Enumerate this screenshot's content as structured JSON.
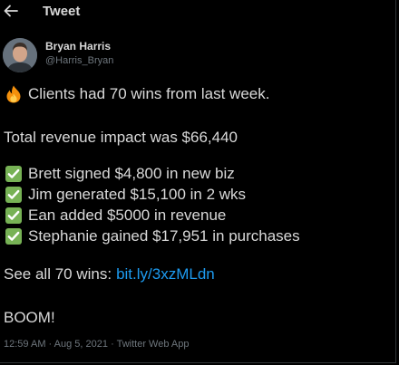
{
  "header": {
    "title": "Tweet",
    "back_icon": "arrow-left-icon"
  },
  "author": {
    "name": "Bryan Harris",
    "handle": "@Harris_Bryan"
  },
  "tweet": {
    "line1_emoji": "fire-icon",
    "line1": "Clients had 70 wins from last week.",
    "line2": "Total revenue impact was $66,440",
    "wins": [
      "Brett signed $4,800 in new biz",
      "Jim generated $15,100 in 2 wks",
      "Ean added $5000 in revenue",
      "Stephanie gained $17,951 in purchases"
    ],
    "wins_icon": "check-mark-button-icon",
    "see_all_text": "See all 70 wins:",
    "see_all_link": "bit.ly/3xzMLdn",
    "closing": "BOOM!"
  },
  "meta": {
    "time": "12:59 AM",
    "date": "Aug 5, 2021",
    "source": "Twitter Web App",
    "separator": "·"
  },
  "colors": {
    "background": "#000000",
    "text": "#d9d9d9",
    "muted": "#6e767d",
    "link": "#1d9bf0",
    "check": "#77b255"
  }
}
